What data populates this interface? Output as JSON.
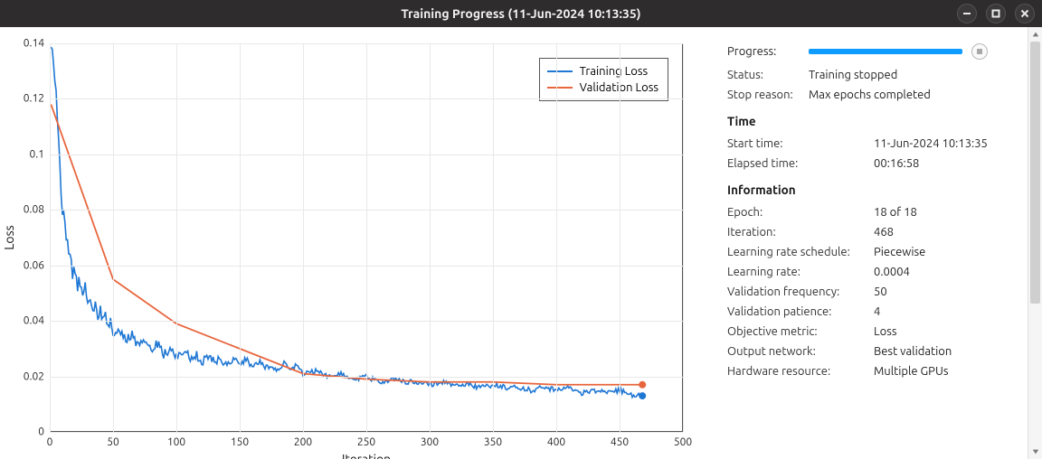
{
  "window": {
    "title": "Training Progress (11-Jun-2024 10:13:35)"
  },
  "panel": {
    "progress_label": "Progress:",
    "status_label": "Status:",
    "status_value": "Training stopped",
    "stopreason_label": "Stop reason:",
    "stopreason_value": "Max epochs completed",
    "time_head": "Time",
    "start_label": "Start time:",
    "start_value": "11-Jun-2024 10:13:35",
    "elapsed_label": "Elapsed time:",
    "elapsed_value": "00:16:58",
    "info_head": "Information",
    "epoch_label": "Epoch:",
    "epoch_value": "18 of 18",
    "iter_label": "Iteration:",
    "iter_value": "468",
    "lrsched_label": "Learning rate schedule:",
    "lrsched_value": "Piecewise",
    "lr_label": "Learning rate:",
    "lr_value": "0.0004",
    "valfreq_label": "Validation frequency:",
    "valfreq_value": "50",
    "valpat_label": "Validation patience:",
    "valpat_value": "4",
    "objmetric_label": "Objective metric:",
    "objmetric_value": "Loss",
    "outnet_label": "Output network:",
    "outnet_value": "Best validation",
    "hw_label": "Hardware resource:",
    "hw_value": "Multiple GPUs"
  },
  "chart_data": {
    "type": "line",
    "title": "",
    "xlabel": "Iteration",
    "ylabel": "Loss",
    "xlim": [
      0,
      500
    ],
    "ylim": [
      0,
      0.14
    ],
    "xticks": [
      0,
      50,
      100,
      150,
      200,
      250,
      300,
      350,
      400,
      450,
      500
    ],
    "yticks": [
      0,
      0.02,
      0.04,
      0.06,
      0.08,
      0.1,
      0.12,
      0.14
    ],
    "legend_position": "northeast",
    "grid": true,
    "colors": {
      "training": "#1f77d4",
      "validation": "#e8663d"
    },
    "series": [
      {
        "name": "Training Loss",
        "x": [
          1,
          2,
          3,
          4,
          5,
          6,
          7,
          8,
          9,
          10,
          12,
          14,
          16,
          18,
          20,
          22,
          24,
          26,
          28,
          30,
          32,
          34,
          36,
          38,
          40,
          42,
          44,
          46,
          48,
          50,
          55,
          60,
          65,
          70,
          75,
          80,
          85,
          90,
          95,
          100,
          105,
          110,
          115,
          120,
          125,
          130,
          135,
          140,
          145,
          150,
          155,
          160,
          165,
          170,
          175,
          180,
          185,
          190,
          195,
          200,
          210,
          220,
          230,
          240,
          250,
          260,
          270,
          280,
          290,
          300,
          310,
          320,
          330,
          340,
          350,
          360,
          370,
          380,
          390,
          400,
          410,
          420,
          430,
          440,
          450,
          460,
          468
        ],
        "y": [
          0.141,
          0.138,
          0.134,
          0.129,
          0.122,
          0.114,
          0.105,
          0.096,
          0.088,
          0.08,
          0.074,
          0.067,
          0.062,
          0.057,
          0.058,
          0.052,
          0.055,
          0.049,
          0.051,
          0.046,
          0.048,
          0.044,
          0.046,
          0.042,
          0.044,
          0.04,
          0.042,
          0.038,
          0.04,
          0.036,
          0.037,
          0.033,
          0.035,
          0.031,
          0.033,
          0.03,
          0.032,
          0.028,
          0.03,
          0.027,
          0.029,
          0.027,
          0.028,
          0.025,
          0.027,
          0.025,
          0.026,
          0.024,
          0.027,
          0.024,
          0.026,
          0.023,
          0.026,
          0.023,
          0.024,
          0.022,
          0.025,
          0.022,
          0.024,
          0.021,
          0.022,
          0.02,
          0.021,
          0.019,
          0.02,
          0.018,
          0.019,
          0.018,
          0.018,
          0.017,
          0.018,
          0.017,
          0.017,
          0.016,
          0.017,
          0.016,
          0.016,
          0.015,
          0.016,
          0.015,
          0.016,
          0.014,
          0.015,
          0.014,
          0.015,
          0.013,
          0.013
        ]
      },
      {
        "name": "Validation Loss",
        "x": [
          1,
          50,
          100,
          150,
          200,
          250,
          300,
          350,
          400,
          450,
          468
        ],
        "y": [
          0.118,
          0.055,
          0.039,
          0.03,
          0.021,
          0.019,
          0.018,
          0.018,
          0.017,
          0.017,
          0.017
        ]
      }
    ],
    "final_markers": [
      {
        "series": "Training Loss",
        "x": 468,
        "y": 0.013
      },
      {
        "series": "Validation Loss",
        "x": 468,
        "y": 0.017
      }
    ]
  }
}
